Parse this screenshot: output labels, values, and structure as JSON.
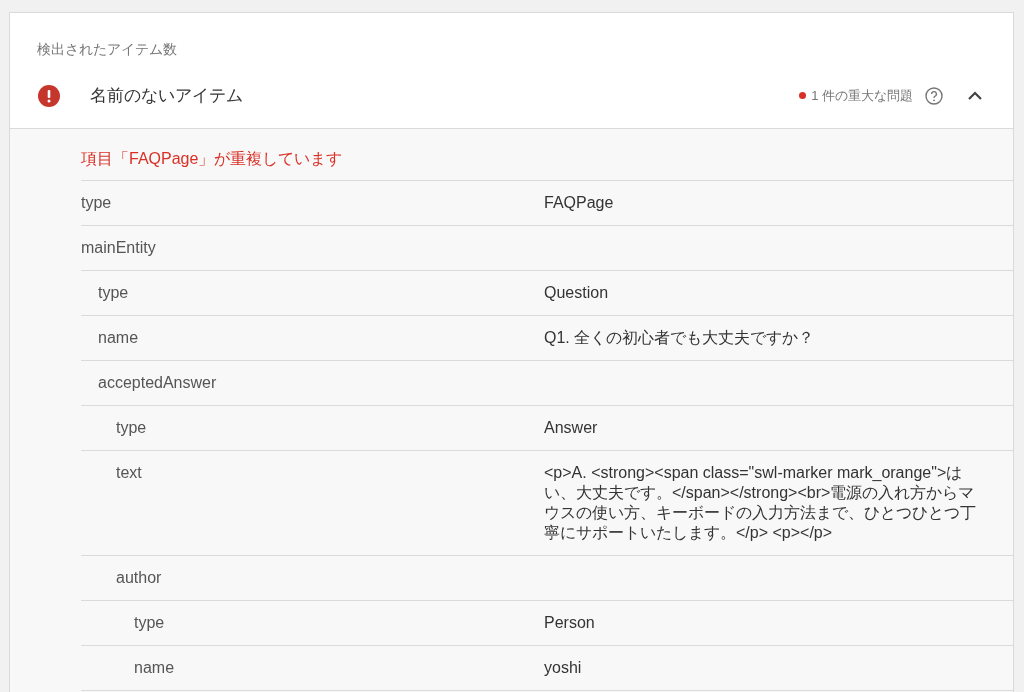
{
  "section_label": "検出されたアイテム数",
  "item": {
    "title": "名前のないアイテム",
    "issue_count": "1 件の重大な問題",
    "expanded": true,
    "error": "項目「FAQPage」が重複しています",
    "properties": [
      {
        "key": "type",
        "value": "FAQPage"
      },
      {
        "key": "mainEntity",
        "children": [
          {
            "key": "type",
            "value": "Question"
          },
          {
            "key": "name",
            "value": "Q1. 全くの初心者でも大丈夫ですか？"
          },
          {
            "key": "acceptedAnswer",
            "children": [
              {
                "key": "type",
                "value": "Answer"
              },
              {
                "key": "text",
                "value": "<p>A. <strong><span class=\"swl-marker mark_orange\">はい、大丈夫です。</span></strong><br>電源の入れ方からマウスの使い方、キーボードの入力方法まで、ひとつひとつ丁寧にサポートいたします。</p> <p></p>"
              },
              {
                "key": "author",
                "children": [
                  {
                    "key": "type",
                    "value": "Person"
                  },
                  {
                    "key": "name",
                    "value": "yoshi"
                  }
                ]
              }
            ]
          }
        ]
      }
    ]
  }
}
